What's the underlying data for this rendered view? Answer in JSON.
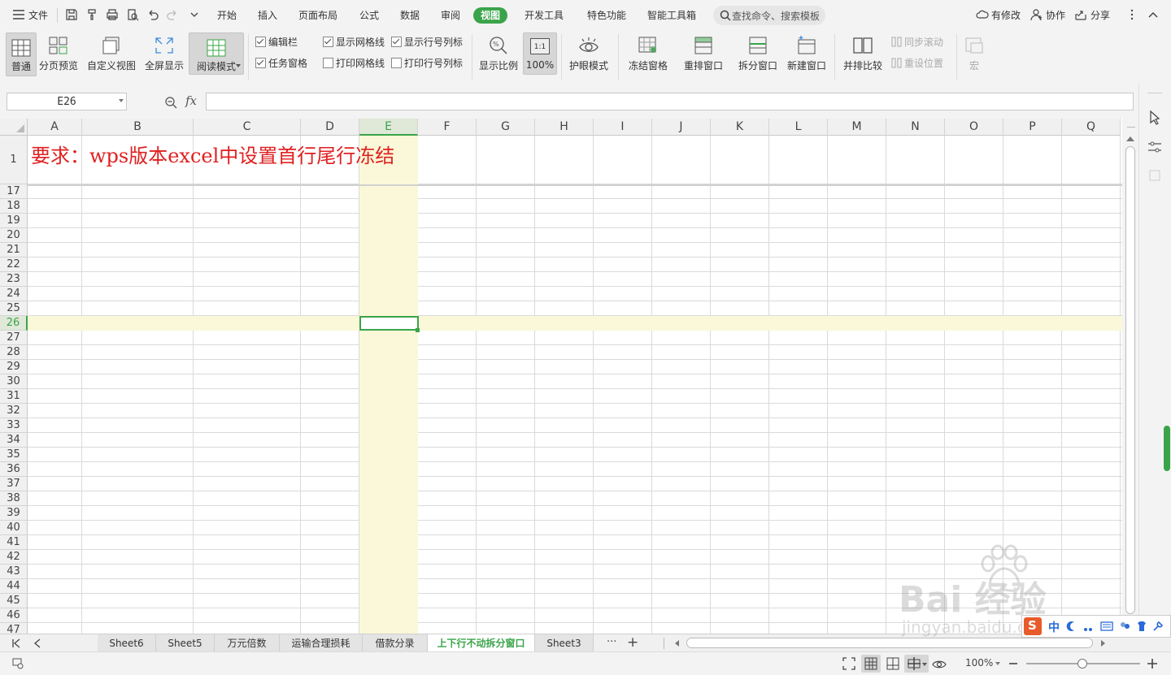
{
  "menubar": {
    "file_label": "文件",
    "tabs": [
      "开始",
      "插入",
      "页面布局",
      "公式",
      "数据",
      "审阅",
      "视图",
      "开发工具",
      "特色功能",
      "智能工具箱"
    ],
    "active_tab": "视图",
    "search_placeholder": "查找命令、搜索模板",
    "right": {
      "modify": "有修改",
      "collab": "协作",
      "share": "分享"
    }
  },
  "ribbon": {
    "view_buttons": [
      "普通",
      "分页预览",
      "自定义视图",
      "全屏显示",
      "阅读模式"
    ],
    "checks": [
      {
        "label": "编辑栏",
        "checked": true
      },
      {
        "label": "任务窗格",
        "checked": true
      },
      {
        "label": "显示网格线",
        "checked": true
      },
      {
        "label": "打印网格线",
        "checked": false
      },
      {
        "label": "显示行号列标",
        "checked": true
      },
      {
        "label": "打印行号列标",
        "checked": false
      }
    ],
    "zoom_buttons": [
      "显示比例",
      "100%"
    ],
    "zoom_icon_text": "1:1",
    "eye_button": "护眼模式",
    "window_buttons": [
      "冻结窗格",
      "重排窗口",
      "拆分窗口",
      "新建窗口"
    ],
    "compare_button": "并排比较",
    "sync_scroll": "同步滚动",
    "reset_pos": "重设位置",
    "macro": "宏"
  },
  "formula_bar": {
    "name_box": "E26",
    "fx": "fx",
    "value": ""
  },
  "grid": {
    "columns": [
      "A",
      "B",
      "C",
      "D",
      "E",
      "F",
      "G",
      "H",
      "I",
      "J",
      "K",
      "L",
      "M",
      "N",
      "O",
      "P",
      "Q"
    ],
    "selected_column": "E",
    "rows": [
      "1",
      "17",
      "18",
      "19",
      "20",
      "21",
      "22",
      "23",
      "24",
      "25",
      "26",
      "27",
      "28",
      "29",
      "30",
      "31",
      "32",
      "33",
      "34",
      "35",
      "36",
      "37",
      "38",
      "39",
      "40",
      "41",
      "42",
      "43",
      "44",
      "45",
      "46",
      "47"
    ],
    "selected_row": "26",
    "title_text": "要求：wps版本excel中设置首行尾行冻结"
  },
  "sheet_tabs": {
    "tabs": [
      "Sheet6",
      "Sheet5",
      "万元倍数",
      "运输合理损耗",
      "借款分录",
      "上下行不动拆分窗口",
      "Sheet3"
    ],
    "active": "上下行不动拆分窗口",
    "more": "···",
    "add": "+"
  },
  "statusbar": {
    "zoom": "100%"
  },
  "watermark": {
    "text": "Bai 经验",
    "url": "jingyan.baidu.com"
  },
  "ime": {
    "lang": "中"
  },
  "colors": {
    "accent": "#3aa44a",
    "highlight": "#faf8d8",
    "title_red": "#e02020"
  }
}
